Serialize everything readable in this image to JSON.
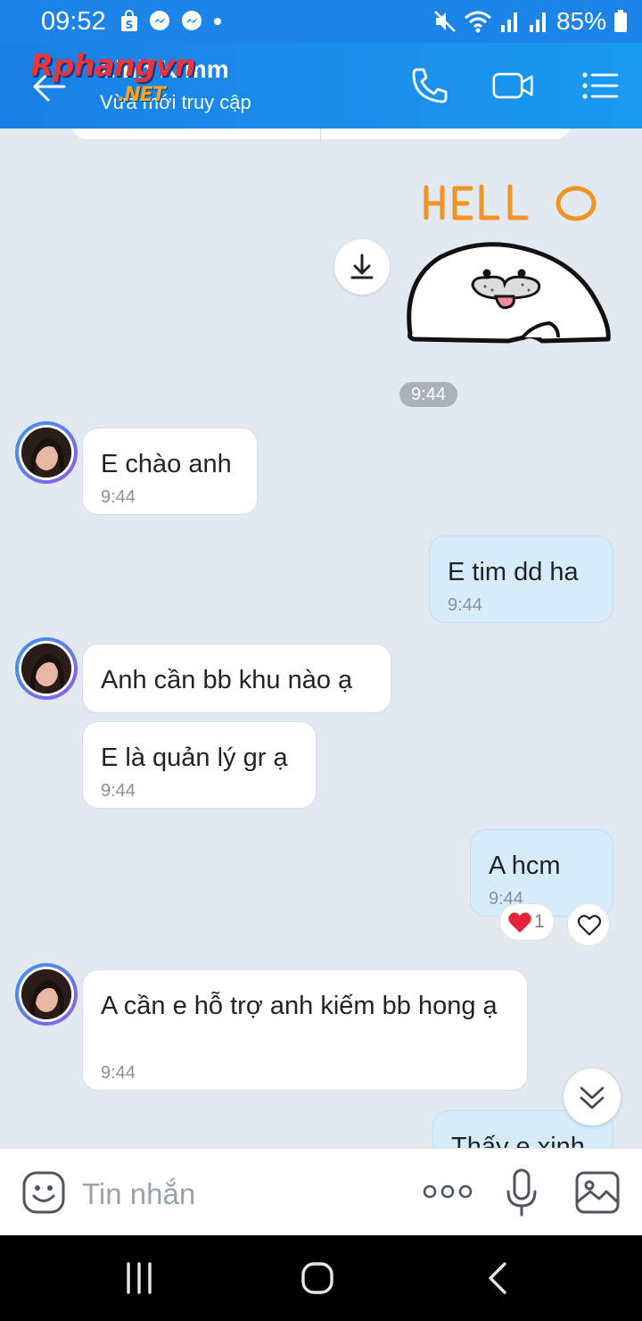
{
  "status_bar": {
    "time": "09:52",
    "battery": "85%"
  },
  "header": {
    "contact_name": "Linh Kimm",
    "contact_status": "Vừa mới truy cập",
    "watermark_main": "Rphangvn",
    "watermark_sub": ".NET"
  },
  "messages": {
    "sticker_time": "9:44",
    "m1": {
      "text": "E chào anh",
      "time": "9:44"
    },
    "m2": {
      "text": "E tim dd ha",
      "time": "9:44"
    },
    "m3": {
      "text": "Anh cần bb khu nào ạ"
    },
    "m4": {
      "text": "E là quản lý gr ạ",
      "time": "9:44"
    },
    "m5": {
      "text": "A hcm",
      "time": "9:44",
      "reaction_count": "1"
    },
    "m6": {
      "text": "A cần e hỗ trợ anh kiếm bb hong ạ",
      "time": "9:44"
    },
    "m7": {
      "text": "Thấy e xinh"
    }
  },
  "input": {
    "placeholder": "Tin nhắn"
  },
  "icons": {
    "back": "back-arrow-icon",
    "call": "phone-icon",
    "video": "video-call-icon",
    "menu": "list-menu-icon",
    "download": "download-icon",
    "heart": "heart-icon",
    "emoji": "emoji-icon",
    "more": "more-icon",
    "mic": "microphone-icon",
    "photo": "image-icon",
    "scroll": "double-chevron-down-icon"
  },
  "colors": {
    "header": "#1a86e8",
    "chat_bg": "#e2e9f1",
    "out_bubble": "#d7ecfb",
    "in_bubble": "#ffffff"
  }
}
